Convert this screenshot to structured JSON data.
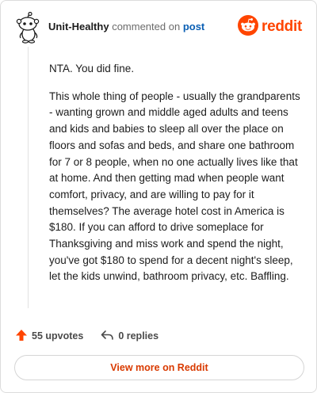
{
  "header": {
    "username": "Unit-Healthy",
    "action": "commented on",
    "target": "post",
    "brand": "reddit",
    "avatar_icon": "snoo-avatar-icon",
    "logo_icon": "reddit-logo-icon"
  },
  "comment": {
    "paragraphs": [
      "NTA. You did fine.",
      "This whole thing of people - usually the grandparents - wanting grown and middle aged adults and teens and kids and babies to sleep all over the place on floors and sofas and beds, and share one bathroom for 7 or 8 people, when no one actually lives like that at home. And then getting mad when people want comfort, privacy, and are willing to pay for it themselves? The average hotel cost in America is $180. If you can afford to drive someplace for Thanksgiving and miss work and spend the night, you've got $180 to spend for a decent night's sleep, let the kids unwind, bathroom privacy, etc. Baffling."
    ]
  },
  "footer": {
    "upvotes_label": "55 upvotes",
    "replies_label": "0 replies",
    "upvote_icon": "upvote-arrow-icon",
    "reply_icon": "reply-arrow-icon"
  },
  "cta": {
    "label": "View more on Reddit"
  },
  "colors": {
    "brand": "#ff4500",
    "link": "#0a5fb4",
    "cta_text": "#d93a00",
    "upvote": "#ff4500"
  }
}
